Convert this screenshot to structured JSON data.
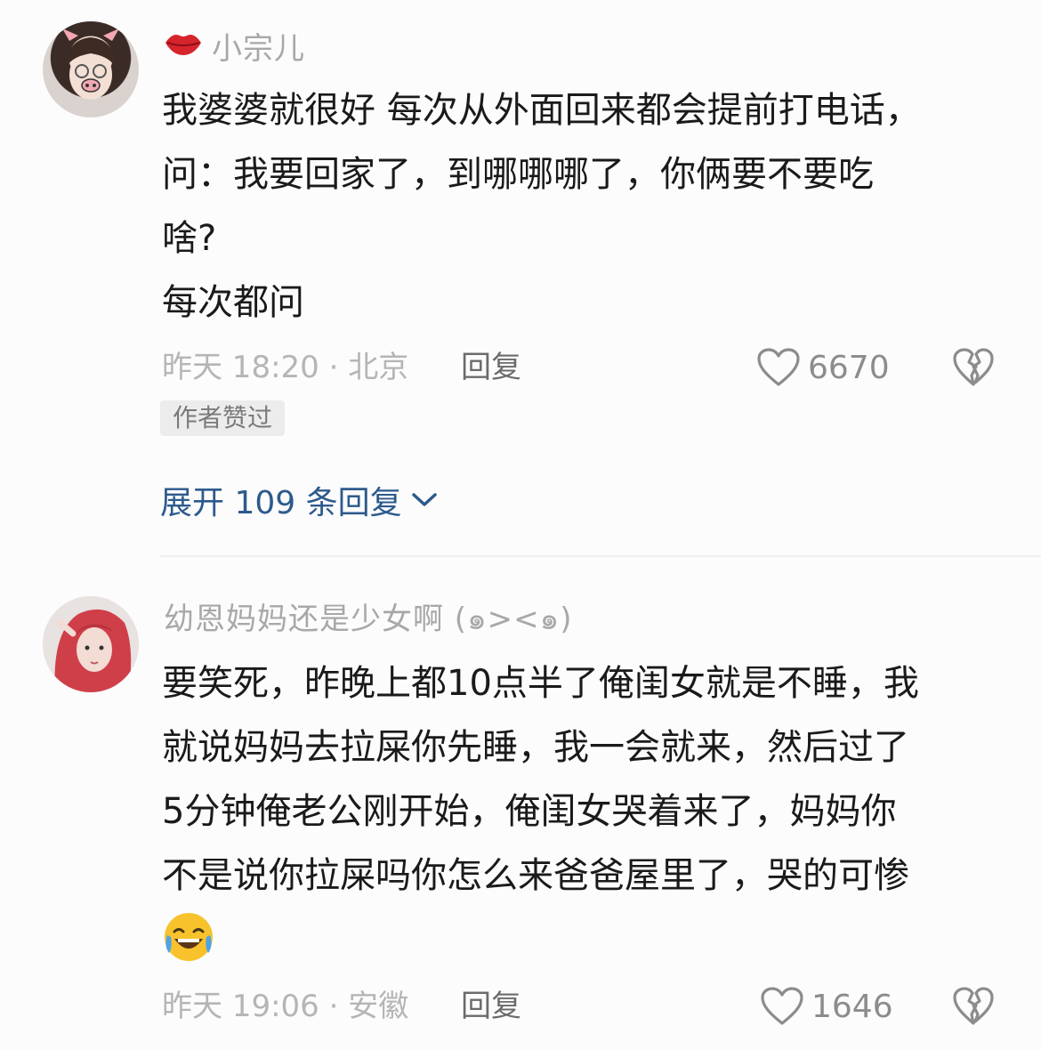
{
  "comments": [
    {
      "username": "小宗儿",
      "body": "我婆婆就很好 每次从外面回来都会提前打电话，\n问：我要回家了，到哪哪哪了，你俩要不要吃\n啥?\n每次都问",
      "time_location": "昨天 18:20 · 北京",
      "reply_label": "回复",
      "like_count": "6670",
      "badge": "作者赞过",
      "expand_label": "展开 109 条回复",
      "name_prefix_icon": "lips-icon"
    },
    {
      "username": "幼恩妈妈还是少女啊 (๑><๑)",
      "body": "要笑死，昨晚上都10点半了俺闺女就是不睡，我\n就说妈妈去拉屎你先睡，我一会就来，然后过了\n5分钟俺老公刚开始，俺闺女哭着来了，妈妈你\n不是说你拉屎吗你怎么来爸爸屋里了，哭的可惨",
      "emoji": "laughing-crying-emoji",
      "time_location": "昨天 19:06 · 安徽",
      "reply_label": "回复",
      "like_count": "1646"
    }
  ],
  "colors": {
    "username": "#a8a8a8",
    "body": "#1a1a1a",
    "meta": "#b5b5b5",
    "expand_link": "#2d5a8c",
    "lips": "#d6242d"
  }
}
